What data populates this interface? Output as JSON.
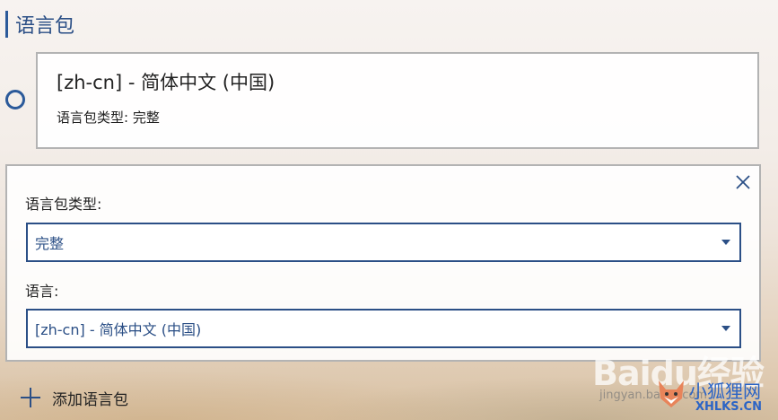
{
  "section": {
    "title": "语言包"
  },
  "card": {
    "title": "[zh-cn] - 简体中文 (中国)",
    "subtitle": "语言包类型: 完整"
  },
  "form": {
    "type_label": "语言包类型:",
    "type_value": "完整",
    "lang_label": "语言:",
    "lang_value": "[zh-cn] - 简体中文 (中国)"
  },
  "add": {
    "label": "添加语言包"
  },
  "watermark": {
    "baidu": "Baidu经验",
    "jingyan": "jingyan.baidu.com",
    "site_name": "小狐狸网",
    "site_url": "XHLKS.CN"
  },
  "colors": {
    "accent": "#2b5a9a",
    "border": "#b3b3b3"
  },
  "icons": {
    "close": "close-icon",
    "caret": "chevron-down-icon",
    "add": "plus-icon",
    "radio": "radio-button"
  }
}
